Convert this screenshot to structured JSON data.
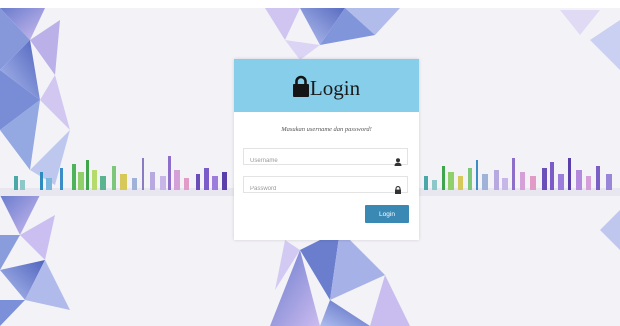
{
  "login_panel": {
    "title": "Login",
    "hint": "Masukan username dan password!",
    "username": {
      "value": "",
      "placeholder": "Username"
    },
    "password": {
      "value": "",
      "placeholder": "Password"
    },
    "submit_label": "Login",
    "header_color": "#87ceeb",
    "button_color": "#3a89b5"
  },
  "icons": {
    "title_icon": "lock-icon",
    "username_icon": "user-icon",
    "password_icon": "lock-icon"
  }
}
